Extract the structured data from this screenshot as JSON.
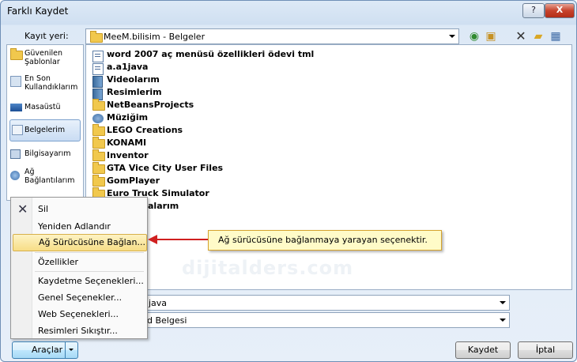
{
  "window": {
    "title": "Farklı Kaydet",
    "help_label": "?",
    "close_label": "X"
  },
  "location": {
    "label": "Kayıt yeri:",
    "value": "MeeM.bilisim - Belgeler"
  },
  "toolbar": {
    "icons": [
      "back-icon",
      "up-folder-icon",
      "delete-icon",
      "new-folder-icon",
      "views-icon"
    ]
  },
  "sidebar": {
    "items": [
      {
        "label": "Güvenilen Şablonlar",
        "line1": "Güvenilen",
        "line2": "Şablonlar",
        "icon": "templates-folder-icon"
      },
      {
        "label": "En Son Kullandıklarım",
        "line1": "En Son",
        "line2": "Kullandıklarım",
        "icon": "recent-icon"
      },
      {
        "label": "Masaüstü",
        "line1": "Masaüstü",
        "line2": "",
        "icon": "desktop-icon"
      },
      {
        "label": "Belgelerim",
        "line1": "Belgelerim",
        "line2": "",
        "icon": "documents-icon"
      },
      {
        "label": "Bilgisayarım",
        "line1": "Bilgisayarım",
        "line2": "",
        "icon": "computer-icon"
      },
      {
        "label": "Ağ Bağlantılarım",
        "line1": "Ağ",
        "line2": "Bağlantılarım",
        "icon": "network-icon"
      }
    ]
  },
  "files": [
    {
      "name": "word 2007 aç menüsü özellikleri ödevi tml",
      "icon": "document"
    },
    {
      "name": "a.a1java",
      "icon": "document"
    },
    {
      "name": "Videolarım",
      "icon": "video"
    },
    {
      "name": "Resimlerim",
      "icon": "video"
    },
    {
      "name": "NetBeansProjects",
      "icon": "folder"
    },
    {
      "name": "Müziğim",
      "icon": "music"
    },
    {
      "name": "LEGO Creations",
      "icon": "folder"
    },
    {
      "name": "KONAMI",
      "icon": "folder"
    },
    {
      "name": "Inventor",
      "icon": "folder"
    },
    {
      "name": "GTA Vice City User Files",
      "icon": "folder"
    },
    {
      "name": "GomPlayer",
      "icon": "folder"
    },
    {
      "name": "Euro Truck Simulator",
      "icon": "folder"
    },
    {
      "name": "alarım",
      "icon": "folder"
    }
  ],
  "watermark": "dijitalders.com",
  "filename": {
    "value": "java"
  },
  "filetype": {
    "value": "d Belgesi"
  },
  "context_menu": {
    "items": [
      {
        "label": "Sil",
        "highlight": false
      },
      {
        "label": "Yeniden Adlandır",
        "highlight": false
      },
      {
        "label": "Ağ Sürücüsüne Bağlan...",
        "highlight": true
      },
      {
        "label": "Özellikler",
        "highlight": false
      },
      {
        "label": "Kaydetme Seçenekleri...",
        "highlight": false
      },
      {
        "label": "Genel Seçenekler...",
        "highlight": false
      },
      {
        "label": "Web Seçenekleri...",
        "highlight": false
      },
      {
        "label": "Resimleri Sıkıştır...",
        "highlight": false
      }
    ]
  },
  "callout": {
    "text": "Ağ sürücüsüne bağlanmaya yarayan seçenektir."
  },
  "buttons": {
    "tools": "Araçlar",
    "save": "Kaydet",
    "cancel": "İptal"
  }
}
